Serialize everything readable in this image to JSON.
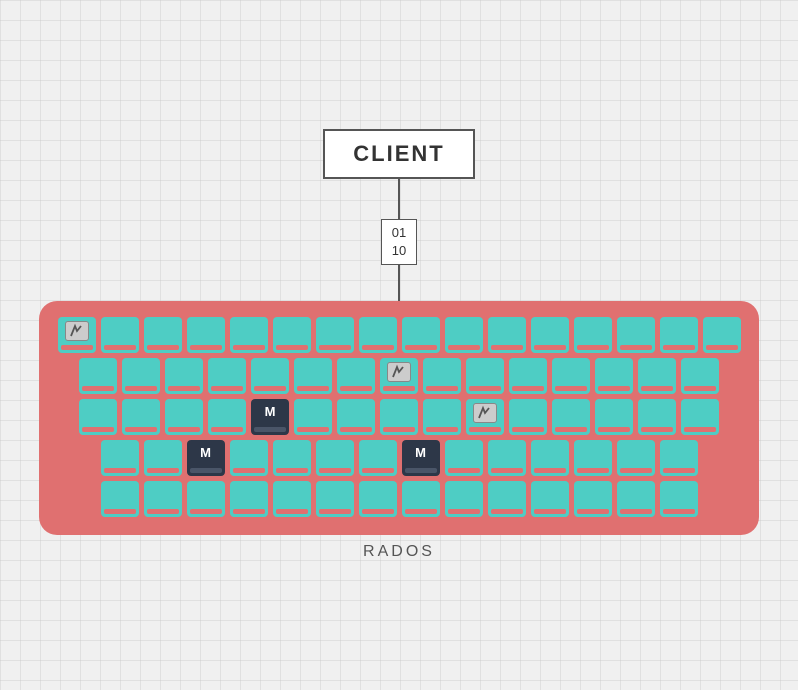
{
  "client": {
    "label": "CLIENT"
  },
  "data_packet": {
    "line1": "01",
    "line2": "10"
  },
  "rados": {
    "label": "RADOS"
  },
  "keyboard": {
    "rows": [
      {
        "keys": [
          {
            "type": "lambda",
            "w": 38
          },
          {
            "type": "normal",
            "w": 38
          },
          {
            "type": "normal",
            "w": 38
          },
          {
            "type": "normal",
            "w": 38
          },
          {
            "type": "normal",
            "w": 38
          },
          {
            "type": "normal",
            "w": 38
          },
          {
            "type": "normal",
            "w": 38
          },
          {
            "type": "normal",
            "w": 38
          },
          {
            "type": "normal",
            "w": 38
          },
          {
            "type": "normal",
            "w": 38
          },
          {
            "type": "normal",
            "w": 38
          },
          {
            "type": "normal",
            "w": 38
          },
          {
            "type": "normal",
            "w": 38
          },
          {
            "type": "normal",
            "w": 38
          },
          {
            "type": "normal",
            "w": 38
          },
          {
            "type": "normal",
            "w": 38
          }
        ]
      },
      {
        "keys": [
          {
            "type": "normal",
            "w": 38
          },
          {
            "type": "normal",
            "w": 38
          },
          {
            "type": "normal",
            "w": 38
          },
          {
            "type": "normal",
            "w": 38
          },
          {
            "type": "normal",
            "w": 38
          },
          {
            "type": "normal",
            "w": 38
          },
          {
            "type": "normal",
            "w": 38
          },
          {
            "type": "lambda",
            "w": 38
          },
          {
            "type": "normal",
            "w": 38
          },
          {
            "type": "normal",
            "w": 38
          },
          {
            "type": "normal",
            "w": 38
          },
          {
            "type": "normal",
            "w": 38
          },
          {
            "type": "normal",
            "w": 38
          },
          {
            "type": "normal",
            "w": 38
          },
          {
            "type": "normal",
            "w": 38
          }
        ]
      },
      {
        "keys": [
          {
            "type": "normal",
            "w": 38
          },
          {
            "type": "normal",
            "w": 38
          },
          {
            "type": "normal",
            "w": 38
          },
          {
            "type": "normal",
            "w": 38
          },
          {
            "type": "dark",
            "w": 38,
            "label": "M"
          },
          {
            "type": "normal",
            "w": 38
          },
          {
            "type": "normal",
            "w": 38
          },
          {
            "type": "normal",
            "w": 38
          },
          {
            "type": "normal",
            "w": 38
          },
          {
            "type": "lambda",
            "w": 38
          },
          {
            "type": "normal",
            "w": 38
          },
          {
            "type": "normal",
            "w": 38
          },
          {
            "type": "normal",
            "w": 38
          },
          {
            "type": "normal",
            "w": 38
          },
          {
            "type": "normal",
            "w": 38
          }
        ]
      },
      {
        "keys": [
          {
            "type": "normal",
            "w": 38
          },
          {
            "type": "normal",
            "w": 38
          },
          {
            "type": "dark",
            "w": 38,
            "label": "M"
          },
          {
            "type": "normal",
            "w": 38
          },
          {
            "type": "normal",
            "w": 38
          },
          {
            "type": "normal",
            "w": 38
          },
          {
            "type": "normal",
            "w": 38
          },
          {
            "type": "dark",
            "w": 38,
            "label": "M"
          },
          {
            "type": "normal",
            "w": 38
          },
          {
            "type": "normal",
            "w": 38
          },
          {
            "type": "normal",
            "w": 38
          },
          {
            "type": "normal",
            "w": 38
          },
          {
            "type": "normal",
            "w": 38
          },
          {
            "type": "normal",
            "w": 38
          }
        ]
      },
      {
        "keys": [
          {
            "type": "normal",
            "w": 38
          },
          {
            "type": "normal",
            "w": 38
          },
          {
            "type": "normal",
            "w": 38
          },
          {
            "type": "normal",
            "w": 38
          },
          {
            "type": "normal",
            "w": 38
          },
          {
            "type": "normal",
            "w": 38
          },
          {
            "type": "normal",
            "w": 38
          },
          {
            "type": "normal",
            "w": 38
          },
          {
            "type": "normal",
            "w": 38
          },
          {
            "type": "normal",
            "w": 38
          },
          {
            "type": "normal",
            "w": 38
          },
          {
            "type": "normal",
            "w": 38
          },
          {
            "type": "normal",
            "w": 38
          },
          {
            "type": "normal",
            "w": 38
          }
        ]
      }
    ]
  }
}
